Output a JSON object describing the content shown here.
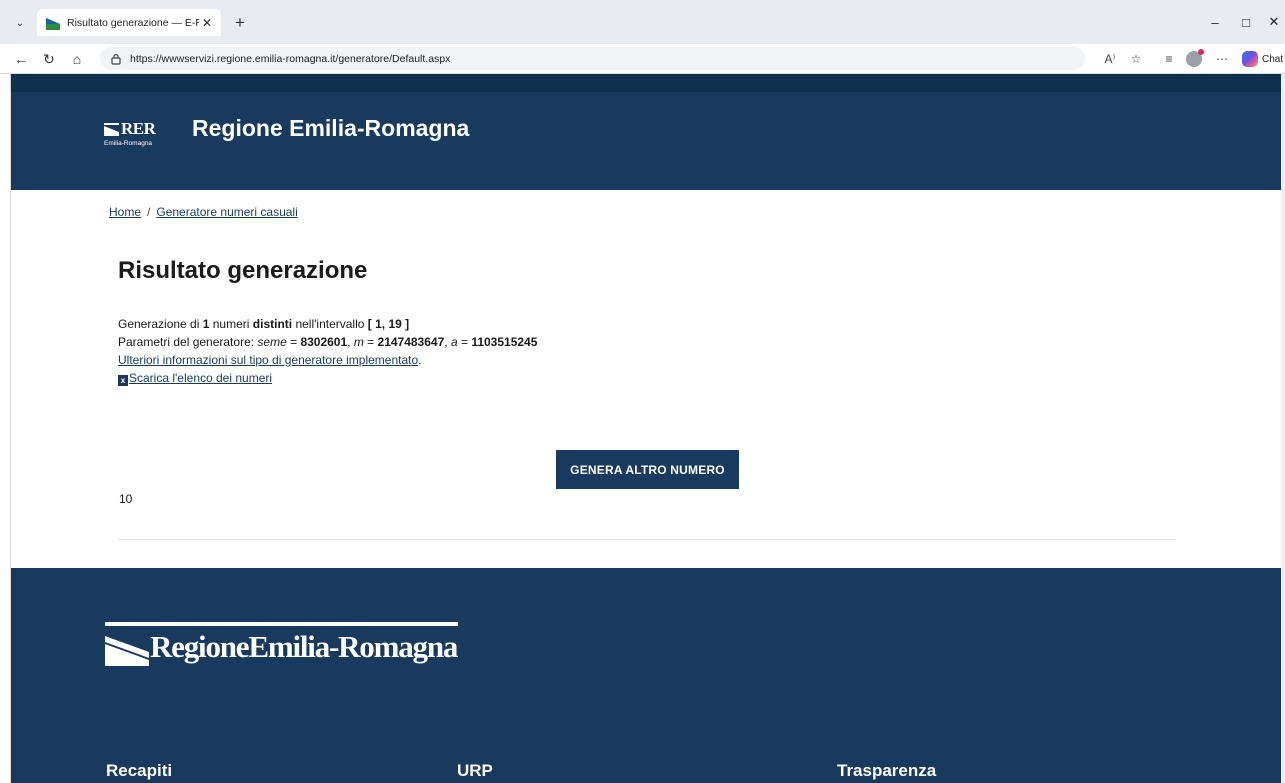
{
  "browser": {
    "tab_title": "Risultato generazione — E-R Il po",
    "url": "https://wwwservizi.regione.emilia-romagna.it/generatore/Default.aspx",
    "copilot_label": "Chat"
  },
  "header": {
    "logo_text": "RER",
    "logo_subtext": "Emilia-Romagna",
    "site_name": "Regione Emilia-Romagna"
  },
  "breadcrumb": {
    "home": "Home",
    "separator": "/",
    "current": "Generatore numeri casuali"
  },
  "main": {
    "title": "Risultato generazione",
    "line1": {
      "prefix": "Generazione di ",
      "count": "1",
      "mid1": " numeri ",
      "kind": "distinti",
      "mid2": " nell'intervallo ",
      "interval": "[ 1, 19 ]"
    },
    "line2": {
      "prefix": "Parametri del generatore: ",
      "seed_label": "seme",
      "eq": " = ",
      "seed_value": "8302601",
      "sep": ", ",
      "m_label": "m",
      "m_value": "2147483647",
      "a_label": "a",
      "a_value": "1103515245"
    },
    "more_info_link": "Ulteriori informazioni sul tipo di generatore implementato",
    "more_info_suffix": ".",
    "download_link": "Scarica l'elenco dei numeri",
    "generate_button": "GENERA ALTRO NUMERO",
    "result": "10"
  },
  "footer": {
    "logo_text": "RegioneEmilia-Romagna",
    "columns": [
      "Recapiti",
      "URP",
      "Trasparenza"
    ]
  },
  "colors": {
    "brand": "#173a5e",
    "top_strip": "#10304f"
  }
}
